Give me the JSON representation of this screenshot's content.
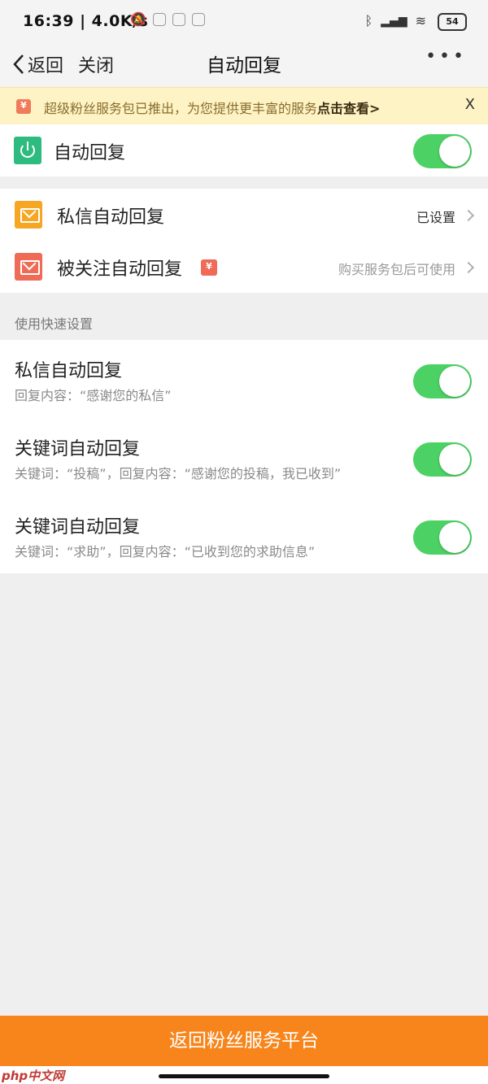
{
  "status_bar": {
    "time": "16:39",
    "net_speed": "4.0K/s",
    "battery": "54"
  },
  "nav": {
    "back_label": "返回",
    "close_label": "关闭",
    "title": "自动回复",
    "more": "•••"
  },
  "notice": {
    "text": "超级粉丝服务包已推出，为您提供更丰富的服务",
    "link": "点击查看>",
    "close": "X"
  },
  "main_toggle": {
    "label": "自动回复",
    "enabled": true
  },
  "settings": {
    "items": [
      {
        "label": "私信自动回复",
        "value": "已设置",
        "value_color": "#333333"
      },
      {
        "label": "被关注自动回复",
        "value": "购买服务包后可使用",
        "value_color": "#9a9a9a"
      }
    ]
  },
  "quick": {
    "section_title": "使用快速设置",
    "items": [
      {
        "title": "私信自动回复",
        "subtitle": "回复内容：“感谢您的私信”",
        "enabled": true
      },
      {
        "title": "关键词自动回复",
        "subtitle": "关键词：“投稿”，回复内容：“感谢您的投稿，我已收到”",
        "enabled": true
      },
      {
        "title": "关键词自动回复",
        "subtitle": "关键词：“求助”，回复内容：“已收到您的求助信息”",
        "enabled": true
      }
    ]
  },
  "bottom_button": "返回粉丝服务平台",
  "watermark": "php中文网",
  "colors": {
    "accent": "#f7851b",
    "toggle_on": "#4cd264",
    "notice_bg": "#fdf3c4"
  }
}
